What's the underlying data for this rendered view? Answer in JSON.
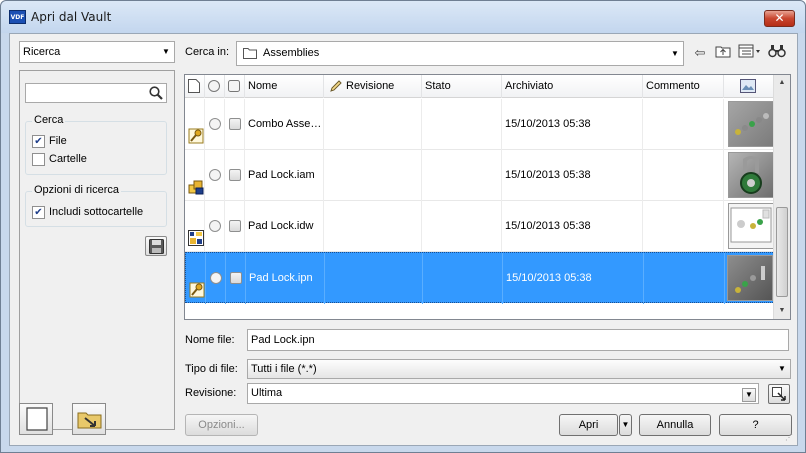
{
  "window": {
    "title": "Apri dal Vault",
    "app_icon_text": "VDF"
  },
  "left_panel": {
    "mode_select": "Ricerca",
    "search": {
      "placeholder": ""
    },
    "cerca_group": {
      "title": "Cerca",
      "options": [
        {
          "label": "File",
          "checked": true
        },
        {
          "label": "Cartelle",
          "checked": false
        }
      ]
    },
    "opzioni_group": {
      "title": "Opzioni di ricerca",
      "options": [
        {
          "label": "Includi sottocartelle",
          "checked": true
        }
      ]
    }
  },
  "toolbar": {
    "cerca_in_label": "Cerca in:",
    "location": "Assemblies"
  },
  "grid": {
    "columns": [
      "Nome",
      "Revisione",
      "Stato",
      "Archiviato",
      "Commento"
    ],
    "rows": [
      {
        "name": "Combo Asse…",
        "revision": "",
        "state": "",
        "archived": "15/10/2013 05:38",
        "comment": "",
        "icon": "assembly-key-icon",
        "selected": false
      },
      {
        "name": "Pad Lock.iam",
        "revision": "",
        "state": "",
        "archived": "15/10/2013 05:38",
        "comment": "",
        "icon": "assembly-blocks-icon",
        "selected": false
      },
      {
        "name": "Pad Lock.idw",
        "revision": "",
        "state": "",
        "archived": "15/10/2013 05:38",
        "comment": "",
        "icon": "drawing-icon",
        "selected": false
      },
      {
        "name": "Pad Lock.ipn",
        "revision": "",
        "state": "",
        "archived": "15/10/2013 05:38",
        "comment": "",
        "icon": "presentation-key-icon",
        "selected": true
      }
    ]
  },
  "fields": {
    "nome_file_label": "Nome file:",
    "nome_file_value": "Pad Lock.ipn",
    "tipo_file_label": "Tipo di file:",
    "tipo_file_value": "Tutti i file (*.*)",
    "revisione_label": "Revisione:",
    "revisione_value": "Ultima"
  },
  "buttons": {
    "opzioni": "Opzioni...",
    "apri": "Apri",
    "annulla": "Annulla",
    "help": "?"
  },
  "colors": {
    "selection": "#3399ff",
    "close": "#c9462f"
  }
}
